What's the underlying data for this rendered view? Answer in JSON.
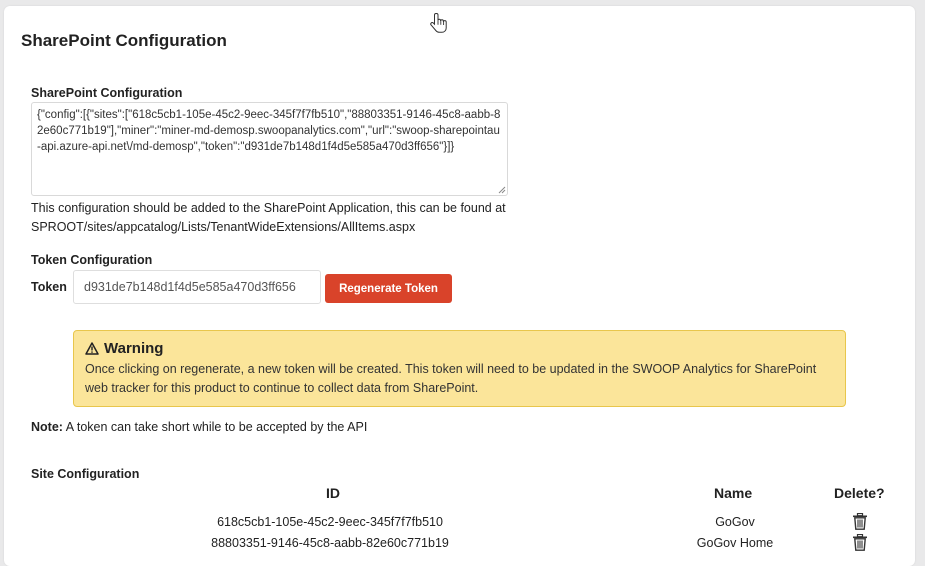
{
  "page": {
    "title": "SharePoint Configuration"
  },
  "config_section": {
    "label": "SharePoint Configuration",
    "value": "{\"config\":[{\"sites\":[\"618c5cb1-105e-45c2-9eec-345f7f7fb510\",\"88803351-9146-45c8-aabb-82e60c771b19\"],\"miner\":\"miner-md-demosp.swoopanalytics.com\",\"url\":\"swoop-sharepointau-api.azure-api.net\\/md-demosp\",\"token\":\"d931de7b148d1f4d5e585a470d3ff656\"}]}",
    "help_line1": "This configuration should be added to the SharePoint Application, this can be found at",
    "help_line2": "SPROOT/sites/appcatalog/Lists/TenantWideExtensions/AllItems.aspx"
  },
  "token_section": {
    "label": "Token Configuration",
    "token_label": "Token",
    "token_value": "d931de7b148d1f4d5e585a470d3ff656",
    "regenerate_label": "Regenerate Token"
  },
  "warning": {
    "icon": "warning-triangle-icon",
    "title": "Warning",
    "body": "Once clicking on regenerate, a new token will be created. This token will need to be updated in the SWOOP Analytics for SharePoint web tracker for this product to continue to collect data from SharePoint."
  },
  "note": {
    "prefix": "Note:",
    "text": " A token can take short while to be accepted by the API"
  },
  "sites": {
    "label": "Site Configuration",
    "headers": {
      "id": "ID",
      "name": "Name",
      "delete": "Delete?"
    },
    "rows": [
      {
        "id": "618c5cb1-105e-45c2-9eec-345f7f7fb510",
        "name": "GoGov"
      },
      {
        "id": "88803351-9146-45c8-aabb-82e60c771b19",
        "name": "GoGov Home"
      }
    ]
  },
  "colors": {
    "accent_button": "#d9432a",
    "warning_bg": "#fbe59a",
    "warning_border": "#e8c64c"
  }
}
